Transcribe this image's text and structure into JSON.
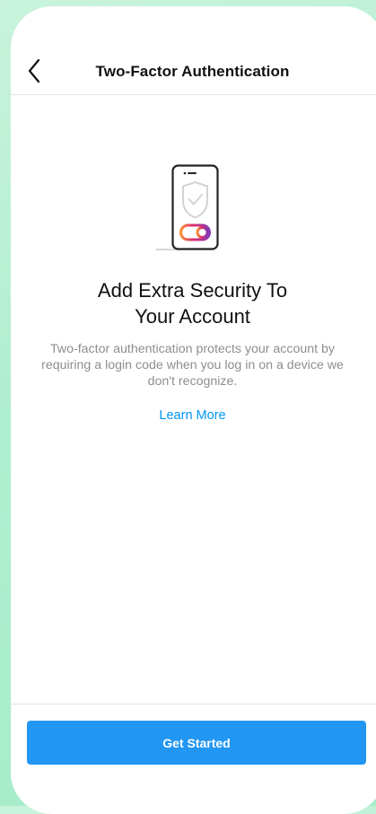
{
  "header": {
    "back_icon": "chevron-left-icon",
    "title": "Two-Factor Authentication"
  },
  "illustration": {
    "icon": "phone-shield-toggle-icon"
  },
  "main": {
    "headline": "Add Extra Security To\nYour Account",
    "description": "Two-factor authentication protects your account by requiring a login code when you log in on a device we don't recognize.",
    "learn_more": "Learn More"
  },
  "footer": {
    "primary_button": "Get Started"
  },
  "colors": {
    "accent": "#0095f6",
    "button": "#2196f3",
    "background": "#aeeed0",
    "secondary_text": "#8e8e8e"
  }
}
